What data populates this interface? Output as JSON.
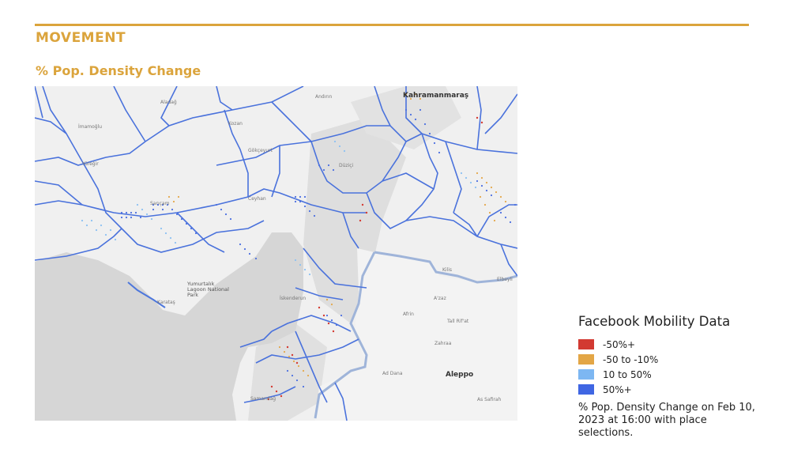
{
  "header": {
    "section_title": "MOVEMENT",
    "subtitle": "% Pop. Density Change",
    "accent_color": "#dba43c"
  },
  "map": {
    "labels": {
      "kahramanmaras": "Kahramanmaraş",
      "duzici": "Düziçi",
      "ceyhan": "Ceyhan",
      "saricam": "Sarıçam",
      "kozan": "Kozan",
      "imamoglu": "İmamoğlu",
      "aladag": "Aladağ",
      "andirin": "Andırın",
      "yumurtalik": "Yumurtalık Lagoon National Park",
      "iskenderun": "İskenderun",
      "azaz": "A'zaz",
      "afrin": "Afrin",
      "tal_rifat": "Tall Rif'at",
      "zahraa": "Zahraa",
      "ad_dana": "Ad Dana",
      "aleppo": "Aleppo",
      "as_safirah": "As Safirah",
      "kilis": "Kilis",
      "elbeyli": "Elbeyli",
      "samandag": "Samandağ",
      "karatas": "Karataş",
      "gokceyurt": "Gökçeyurt",
      "yuregir": "Yüreğir"
    }
  },
  "legend": {
    "title": "Facebook Mobility Data",
    "items": [
      {
        "label": "-50%+",
        "color": "#d23a32"
      },
      {
        "label": "-50 to -10%",
        "color": "#e3a646"
      },
      {
        "label": "10 to 50%",
        "color": "#7db7f2"
      },
      {
        "label": "50%+",
        "color": "#3f66e3"
      }
    ]
  },
  "note": "% Pop. Density Change on Feb 10, 2023 at 16:00 with place selections."
}
